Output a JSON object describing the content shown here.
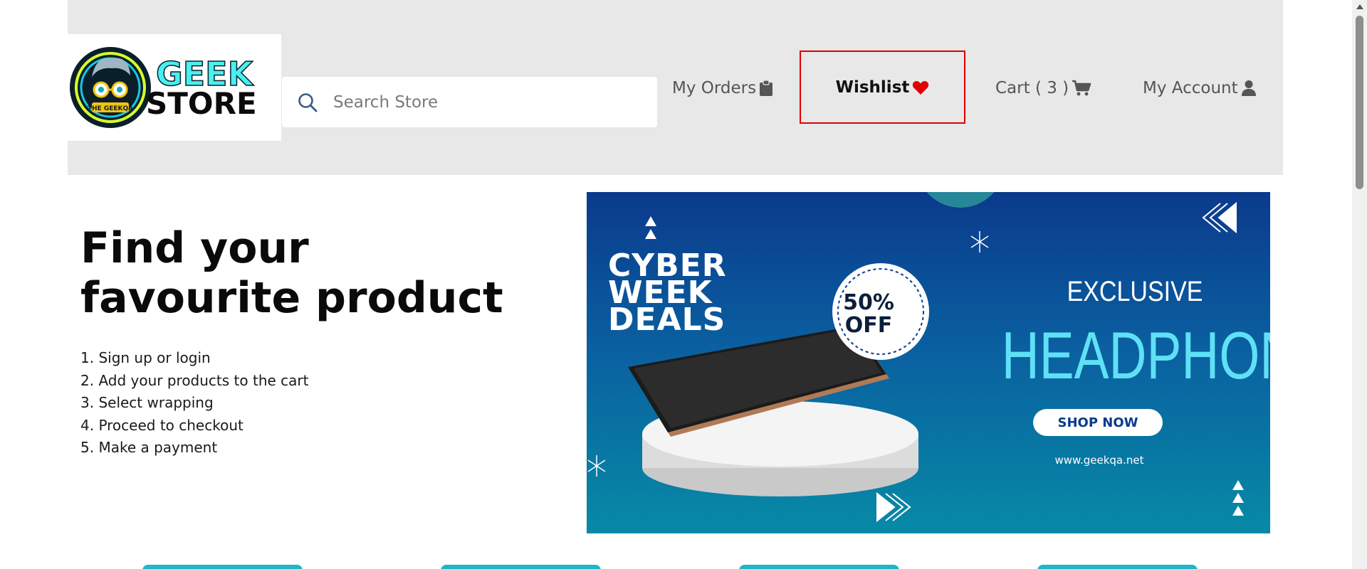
{
  "header": {
    "logo": {
      "line1": "GEEK",
      "line2": "STORE",
      "badge": "THE GEEKQA"
    },
    "search": {
      "placeholder": "Search Store",
      "icon": "search-icon"
    },
    "nav": {
      "orders_label": "My Orders",
      "orders_icon": "clipboard-icon",
      "wishlist_label": "Wishlist",
      "wishlist_icon": "heart-icon",
      "cart_label": "Cart ( 3 )",
      "cart_icon": "cart-icon",
      "account_label": "My Account",
      "account_icon": "user-icon"
    },
    "colors": {
      "header_bg": "#e8e8e8",
      "highlight_border": "#e00000",
      "heart": "#e00000"
    }
  },
  "hero": {
    "title": "Find your favourite product",
    "steps": [
      "1. Sign up or login",
      "2. Add your products to the cart",
      "3. Select wrapping",
      "4. Proceed to checkout",
      "5. Make a payment"
    ]
  },
  "banner": {
    "cyber": "CYBER WEEK DEALS",
    "discount_line1": "50%",
    "discount_line2": "OFF",
    "exclusive": "EXCLUSIVE",
    "headline": "HEADPHONE",
    "cta": "SHOP NOW",
    "url": "www.geekqa.net",
    "colors": {
      "accent": "#5fe0f6",
      "cta_text": "#0b3a8c"
    }
  }
}
